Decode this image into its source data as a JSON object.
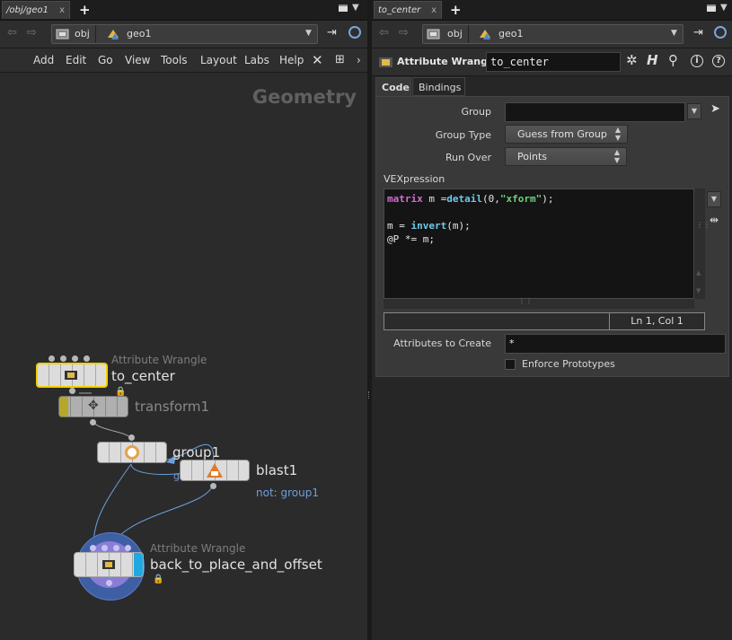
{
  "left_pane": {
    "tab": {
      "label": "/obj/geo1",
      "close": "x"
    },
    "new_tab": "+",
    "path": {
      "root": "obj",
      "current": "geo1"
    },
    "menu": [
      "Add",
      "Edit",
      "Go",
      "View",
      "Tools",
      "Layout",
      "Labs",
      "Help"
    ],
    "context_label": "Geometry",
    "nodes": [
      {
        "type": "Attribute Wrangle",
        "name": "to_center"
      },
      {
        "type": "",
        "name": "transform1"
      },
      {
        "type": "",
        "name": "group1"
      },
      {
        "type": "",
        "name": "blast1",
        "sub": "not: group1"
      },
      {
        "type": "Attribute Wrangle",
        "name": "back_to_place_and_offset"
      }
    ],
    "wire_label": "group1"
  },
  "right_pane": {
    "tab": {
      "label": "to_center",
      "close": "x"
    },
    "new_tab": "+",
    "path": {
      "root": "obj",
      "current": "geo1"
    },
    "node_type": "Attribute Wrangle",
    "node_name": "to_center",
    "tabs": [
      "Code",
      "Bindings"
    ],
    "params": {
      "group_label": "Group",
      "group_value": "",
      "group_type_label": "Group Type",
      "group_type_value": "Guess from Group",
      "run_over_label": "Run Over",
      "run_over_value": "Points",
      "vex_label": "VEXpression",
      "code": {
        "line1": {
          "kw": "matrix",
          "a": " m =",
          "fn": "detail",
          "b": "(0,",
          "st": "\"xform\"",
          "c": ");"
        },
        "line3": {
          "a": "m = ",
          "fn": "invert",
          "b": "(m);"
        },
        "line4": "@P *= m;"
      },
      "status_position": "Ln 1, Col 1",
      "attributes_label": "Attributes to Create",
      "attributes_value": "*",
      "enforce_label": "Enforce Prototypes"
    }
  }
}
